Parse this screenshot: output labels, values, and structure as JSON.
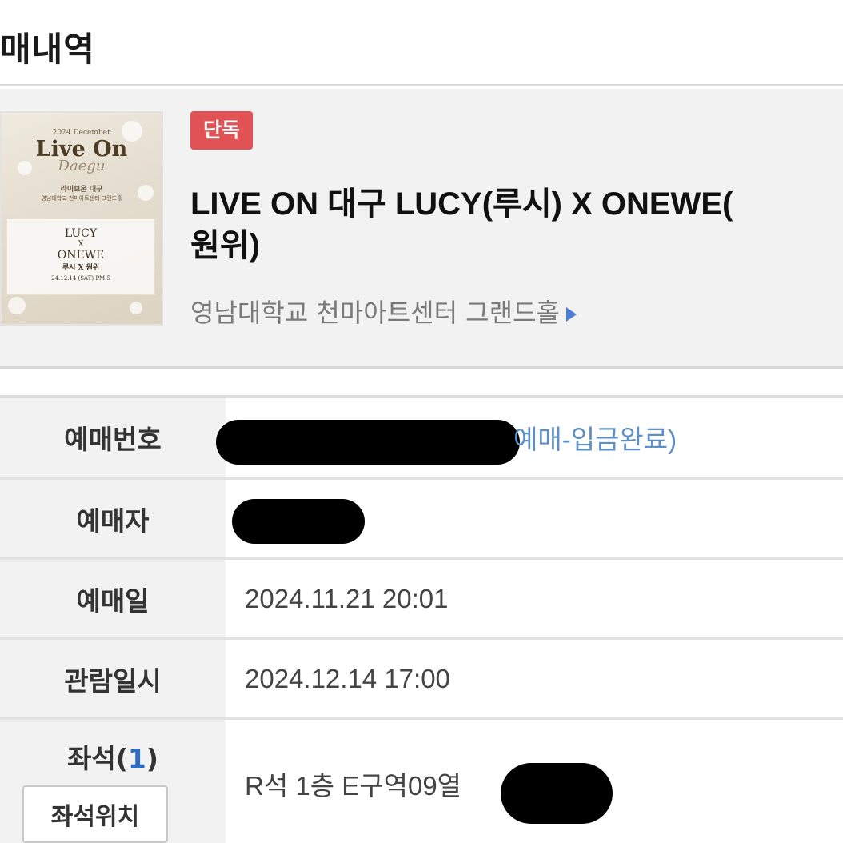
{
  "page": {
    "title": "매내역"
  },
  "event": {
    "badge": "단독",
    "title_line1": "LIVE ON 대구 LUCY(루시) X ONEWE(",
    "title_line2": "원위)",
    "venue": "영남대학교 천마아트센터 그랜드홀",
    "venue_arrow_icon": "triangle-right-icon",
    "poster": {
      "year_month": "2024 December",
      "title": "Live On",
      "subtitle": "Daegu",
      "line1": "라이브온 대구",
      "line2": "영남대학교 천마아트센터 그랜드홀",
      "artist1": "LUCY",
      "x": "X",
      "artist2": "ONEWE",
      "artists_ko": "루시 X 원위",
      "date": "24.12.14 (SAT) PM 5"
    }
  },
  "details": {
    "reservation_number": {
      "label": "예매번호",
      "status": "예매-입금완료)"
    },
    "booker": {
      "label": "예매자"
    },
    "booking_date": {
      "label": "예매일",
      "value": "2024.11.21 20:01"
    },
    "show_datetime": {
      "label": "관람일시",
      "value": "2024.12.14 17:00"
    },
    "seat": {
      "label": "좌석(",
      "count": "1",
      "label_close": ")",
      "button": "좌석위치",
      "value": "R석 1층 E구역09열"
    }
  },
  "colors": {
    "badge": "#e05254",
    "link": "#5d8fc9",
    "seat_count": "#2f6cc8",
    "arrow": "#4a7fd4"
  }
}
